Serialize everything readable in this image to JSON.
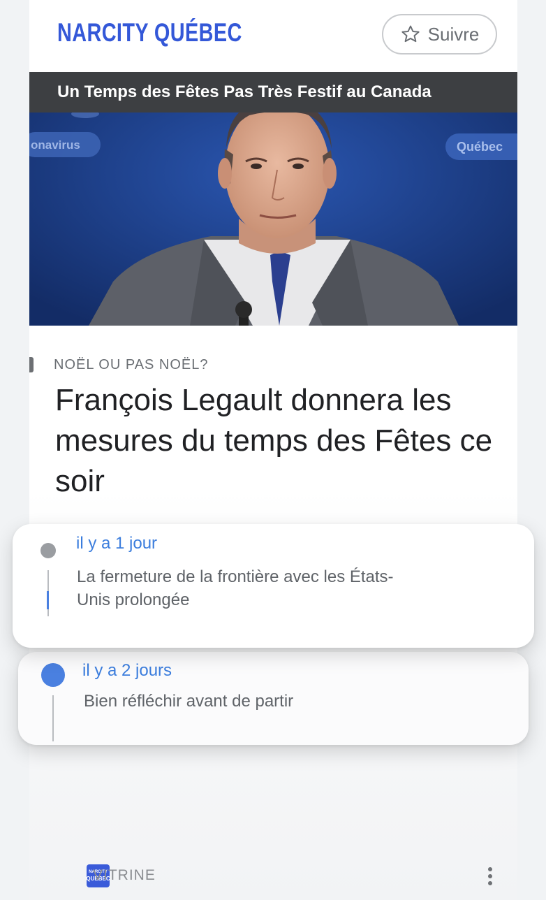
{
  "publisher": {
    "name": "NARCITY QUÉBEC",
    "follow_label": "Suivre",
    "accent": "#3458d8"
  },
  "story": {
    "banner": "Un Temps des Fêtes Pas Très Festif au Canada",
    "image_text_left": "onavirus",
    "image_text_right": "Québec",
    "kicker": "NOËL OU PAS NOËL?",
    "headline": "François Legault donnera les mesures du temps des Fêtes ce soir"
  },
  "timeline": [
    {
      "time": "il y a 1 jour",
      "title": "La fermeture de la frontière avec les États-Unis prolongée"
    },
    {
      "time": "il y a 2 jours",
      "title": "Bien réfléchir avant de partir"
    }
  ],
  "footer": {
    "badge_line1": "NARCITY",
    "badge_line2": "QUÉBEC",
    "label": "VITRINE"
  },
  "colors": {
    "link_blue": "#3b7ddd",
    "dot_gray": "#9a9da1",
    "dot_blue": "#4a80e0"
  },
  "icons": [
    "star-outline-icon",
    "more-vert-icon"
  ]
}
